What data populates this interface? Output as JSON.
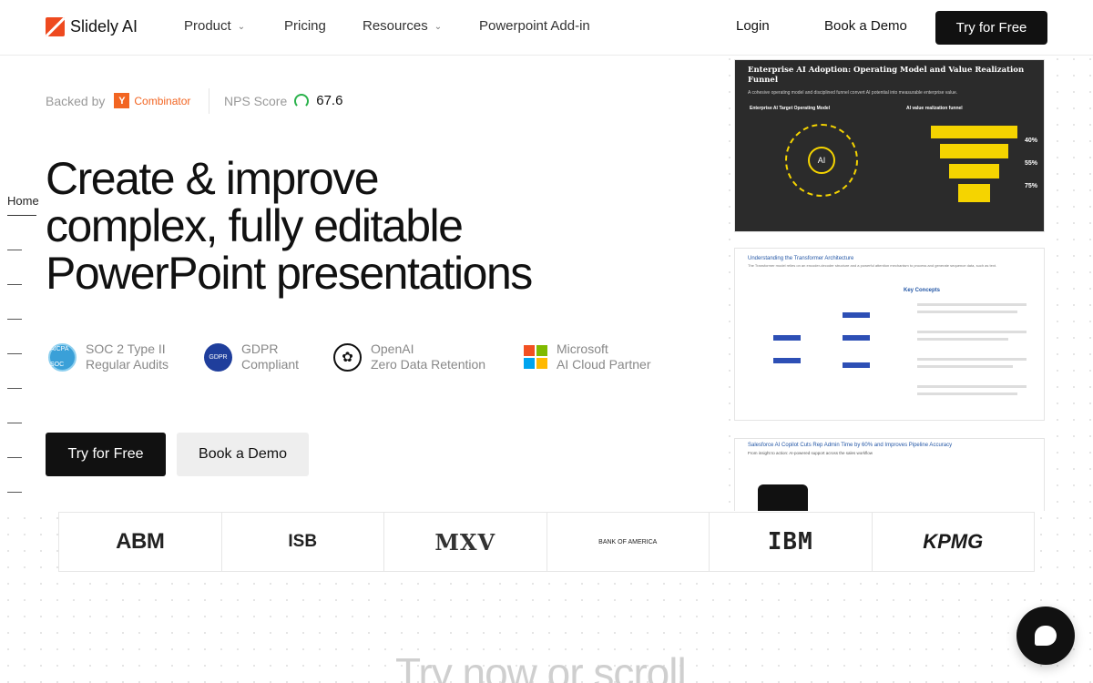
{
  "brand": {
    "name": "Slidely AI",
    "color": "#ee4a1f"
  },
  "nav": {
    "items": [
      {
        "label": "Product",
        "dropdown": true
      },
      {
        "label": "Pricing",
        "dropdown": false
      },
      {
        "label": "Resources",
        "dropdown": true
      },
      {
        "label": "Powerpoint Add-in",
        "dropdown": false
      }
    ],
    "login": "Login",
    "book_demo": "Book a Demo",
    "try_free": "Try for Free"
  },
  "hero": {
    "backed_by": "Backed by",
    "yc_mark": "Y",
    "yc_name": "Combinator",
    "nps_label": "NPS Score",
    "nps_value": "67.6",
    "headline_line1": "Create & improve",
    "headline_line2": "complex, fully editable",
    "headline_line3": "PowerPoint presentations",
    "badges": [
      {
        "line1": "SOC 2 Type II",
        "line2": "Regular Audits",
        "icon": "soc-badge-icon",
        "icon_text": "AICPA SOC"
      },
      {
        "line1": "GDPR",
        "line2": "Compliant",
        "icon": "gdpr-badge-icon",
        "icon_text": "GDPR"
      },
      {
        "line1": "OpenAI",
        "line2": "Zero Data Retention",
        "icon": "openai-icon",
        "icon_text": "✿"
      },
      {
        "line1": "Microsoft",
        "line2": "AI Cloud Partner",
        "icon": "microsoft-icon"
      }
    ],
    "cta_try": "Try for Free",
    "cta_demo": "Book a Demo"
  },
  "side_nav": {
    "active": "Home"
  },
  "slides": [
    {
      "title": "Enterprise AI Adoption: Operating Model and Value Realization Funnel",
      "subtitle": "A cohesive operating model and disciplined funnel convert AI potential into measurable enterprise value.",
      "left_heading": "Enterprise AI Target Operating Model",
      "right_heading": "AI value realization funnel",
      "center": "AI",
      "percents": [
        "40%",
        "55%",
        "75%"
      ]
    },
    {
      "title": "Understanding the Transformer Architecture",
      "subtitle": "The Transformer model relies on an encoder-decoder structure and a powerful attention mechanism to process and generate sequence data, such as text.",
      "key_concepts": "Key Concepts"
    },
    {
      "title": "Salesforce AI Copilot Cuts Rep Admin Time by 60% and Improves Pipeline Accuracy",
      "subtitle": "From insight to action: AI-powered support across the sales workflow"
    }
  ],
  "logos": [
    "ABM",
    "ISB",
    "MXV",
    "BANK OF AMERICA",
    "IBM",
    "KPMG"
  ],
  "bottom_text": "Try now or scroll"
}
